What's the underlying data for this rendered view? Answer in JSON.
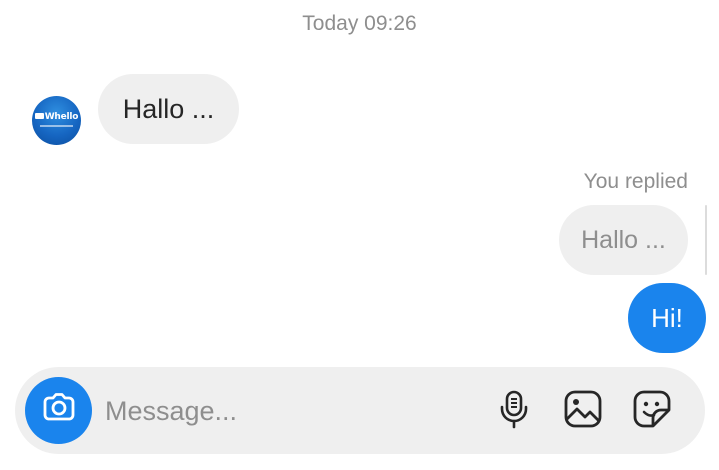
{
  "thread": {
    "timestamp": "Today 09:26",
    "messages": [
      {
        "direction": "incoming",
        "text": "Hallo ...",
        "sender_avatar": "Whello"
      },
      {
        "direction": "outgoing",
        "reply_label": "You replied",
        "quoted_text": "Hallo ...",
        "text": "Hi!"
      }
    ]
  },
  "composer": {
    "placeholder": "Message...",
    "icons": [
      "camera-icon",
      "microphone-icon",
      "gallery-icon",
      "sticker-icon"
    ]
  },
  "colors": {
    "accent": "#1a84ed",
    "bubble_gray": "#efefef",
    "secondary_text": "#8e8e8e",
    "primary_text": "#262626"
  }
}
